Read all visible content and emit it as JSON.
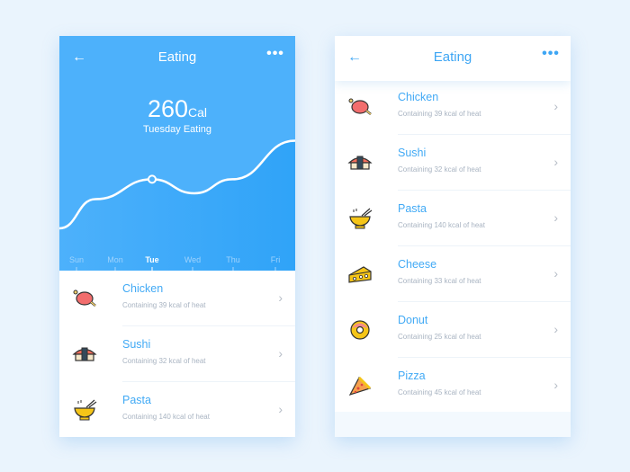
{
  "left_screen": {
    "title": "Eating",
    "back_icon": "←",
    "more_icon": "•••",
    "calories_value": "260",
    "calories_unit": "Cal",
    "subtitle": "Tuesday Eating",
    "colors": {
      "hero": "#4db1fb",
      "accent": "#3ea6f4"
    },
    "chart_data": {
      "type": "line",
      "categories": [
        "Sun",
        "Mon",
        "Tue",
        "Wed",
        "Thu",
        "Fri"
      ],
      "selected": "Tue",
      "values": [
        20,
        45,
        62,
        50,
        62,
        95
      ],
      "ylim": [
        0,
        100
      ]
    },
    "items": [
      {
        "name": "Chicken",
        "desc": "Containing 39 kcal of heat",
        "icon": "chicken-icon"
      },
      {
        "name": "Sushi",
        "desc": "Containing 32 kcal of heat",
        "icon": "sushi-icon"
      },
      {
        "name": "Pasta",
        "desc": "Containing 140 kcal of heat",
        "icon": "pasta-icon"
      }
    ]
  },
  "right_screen": {
    "title": "Eating",
    "back_icon": "←",
    "more_icon": "•••",
    "items": [
      {
        "name": "Chicken",
        "desc": "Containing 39 kcal of heat",
        "icon": "chicken-icon"
      },
      {
        "name": "Sushi",
        "desc": "Containing 32 kcal of heat",
        "icon": "sushi-icon"
      },
      {
        "name": "Pasta",
        "desc": "Containing 140 kcal of heat",
        "icon": "pasta-icon"
      },
      {
        "name": "Cheese",
        "desc": "Containing 33 kcal of heat",
        "icon": "cheese-icon"
      },
      {
        "name": "Donut",
        "desc": "Containing 25 kcal of heat",
        "icon": "donut-icon"
      },
      {
        "name": "Pizza",
        "desc": "Containing 45 kcal of heat",
        "icon": "pizza-icon"
      }
    ]
  },
  "chevron": "›"
}
